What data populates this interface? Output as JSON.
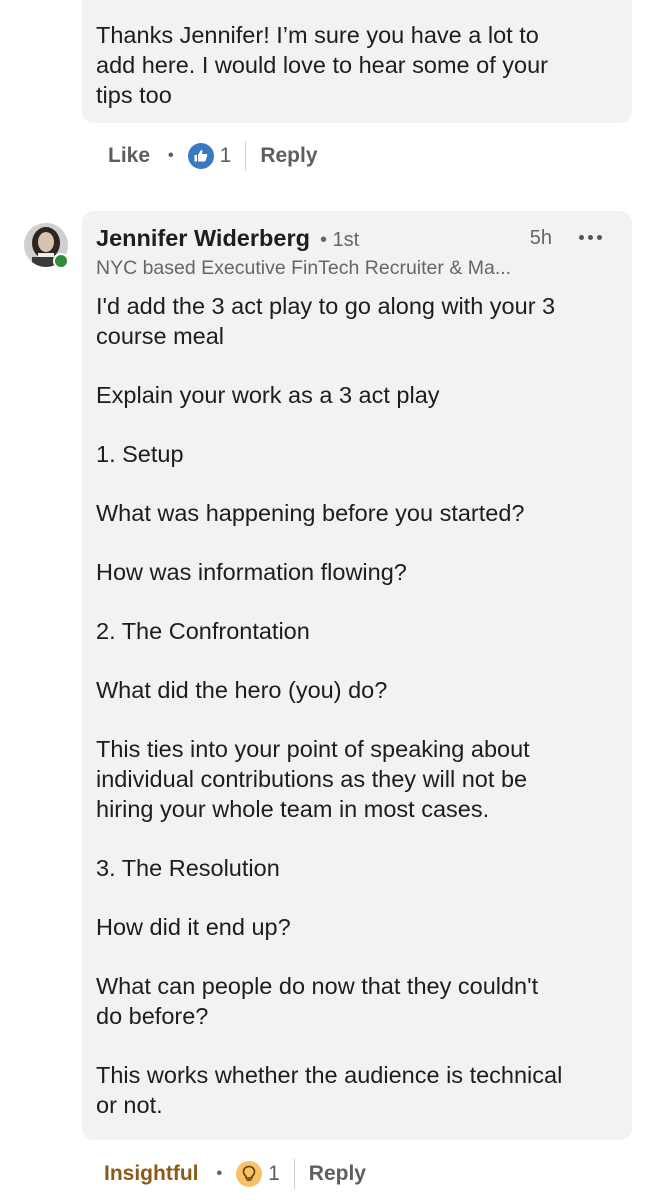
{
  "previous_comment": {
    "text": "Thanks Jennifer! I’m sure you have a lot to\nadd here. I would love to hear some of your\ntips too",
    "like_label": "Like",
    "reaction_count": "1",
    "reply_label": "Reply"
  },
  "comment": {
    "author": "Jennifer Widerberg",
    "degree": "1st",
    "time": "5h",
    "headline": "NYC based Executive FinTech Recruiter & Ma...",
    "paragraphs": [
      "I'd add the 3 act play to go along with your 3\ncourse meal",
      "Explain your work as a 3 act play",
      "1. Setup",
      "What was happening before you started?",
      "How was information flowing?",
      "2. The Confrontation",
      "What did the hero (you) do?",
      "This ties into your point of speaking about\nindividual contributions as they will not be\nhiring your whole team in most cases.",
      "3. The Resolution",
      "How did it end up?",
      "What can people do now that they couldn't\ndo before?",
      "This works whether the audience is technical\nor not."
    ],
    "reaction_label": "Insightful",
    "reaction_count": "1",
    "reply_label": "Reply"
  },
  "icons": {
    "like_reaction": "thumbs-up-icon",
    "insightful_reaction": "lightbulb-icon",
    "more": "more-options-icon",
    "online": "online-status-icon"
  },
  "colors": {
    "bubble": "#f2f2f2",
    "like_blue": "#3a78c2",
    "insightful_text": "#8a5a16",
    "insightful_icon": "#f7c264",
    "online_green": "#2f8c3a"
  }
}
